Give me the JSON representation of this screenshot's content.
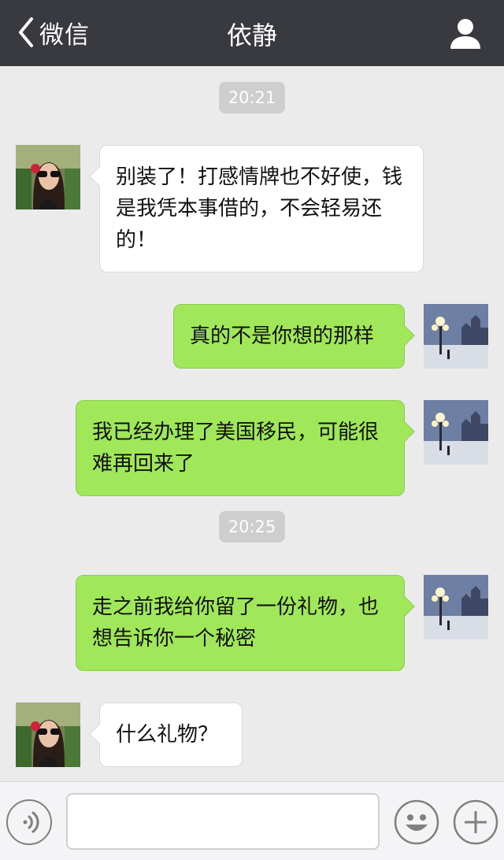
{
  "header": {
    "back_label": "微信",
    "title": "依静"
  },
  "messages": [
    {
      "type": "time",
      "text": "20:21"
    },
    {
      "type": "message",
      "direction": "in",
      "text": "别装了！打感情牌也不好使，钱是我凭本事借的，不会轻易还的！"
    },
    {
      "type": "message",
      "direction": "out",
      "text": "真的不是你想的那样"
    },
    {
      "type": "message",
      "direction": "out",
      "text": "我已经办理了美国移民，可能很难再回来了"
    },
    {
      "type": "time",
      "text": "20:25"
    },
    {
      "type": "message",
      "direction": "out",
      "text": "走之前我给你留了一份礼物，也想告诉你一个秘密"
    },
    {
      "type": "message",
      "direction": "in",
      "text": "什么礼物？"
    }
  ],
  "input": {
    "value": "",
    "placeholder": ""
  },
  "colors": {
    "header_bg": "#393a3f",
    "chat_bg": "#ebebeb",
    "outgoing_bubble": "#a0e75a",
    "incoming_bubble": "#ffffff",
    "time_pill": "#cecece"
  },
  "icons": {
    "back": "chevron-left-icon",
    "profile": "person-icon",
    "voice": "voice-icon",
    "emoji": "smiley-icon",
    "more": "plus-icon"
  }
}
